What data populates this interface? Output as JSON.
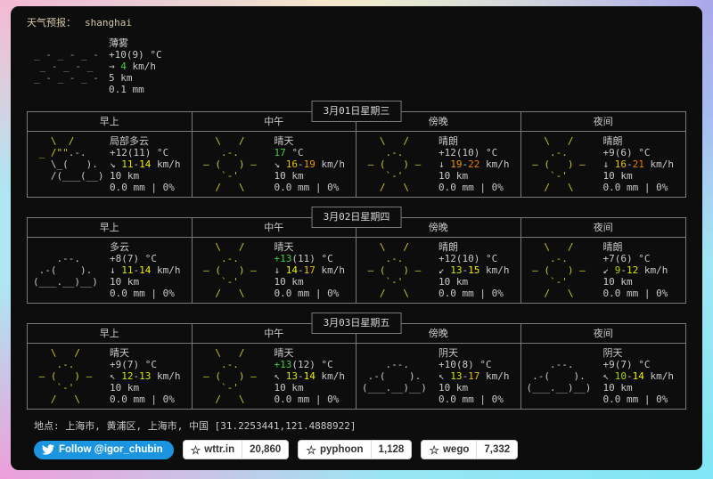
{
  "header": {
    "label": "天气预报：",
    "city": "shanghai"
  },
  "colors": {
    "d": "#c9c9c9",
    "m": "#9a9a9a",
    "y": "#c9c926",
    "g": "#44cc44",
    "yg": "#a8d400",
    "y1": "#d6e600",
    "y2": "#f0f000",
    "gold": "#e6c300",
    "o1": "#e89a00",
    "o2": "#e87c00"
  },
  "arts": {
    "mist": [
      [
        [
          "",
          ""
        ]
      ],
      [
        [
          "_ - _ - _ -",
          "m"
        ]
      ],
      [
        [
          " _ - _ - _",
          "m"
        ]
      ],
      [
        [
          "_ - _ - _ -",
          "m"
        ]
      ],
      [
        [
          "",
          ""
        ]
      ]
    ],
    "partly": [
      [
        [
          "   \\  /",
          "y"
        ]
      ],
      [
        [
          " _ /\"\"",
          "y"
        ],
        [
          ".-.",
          "d"
        ]
      ],
      [
        [
          "   \\_(   ).",
          "d"
        ]
      ],
      [
        [
          "   /(___(__)",
          "d"
        ]
      ],
      [
        [
          "",
          ""
        ]
      ]
    ],
    "sun": [
      [
        [
          "   \\   /",
          "y"
        ]
      ],
      [
        [
          "    .-.",
          "y"
        ]
      ],
      [
        [
          " ― (   ) ―",
          "y"
        ]
      ],
      [
        [
          "    `-'",
          "y"
        ]
      ],
      [
        [
          "   /   \\",
          "y"
        ]
      ]
    ],
    "cloud": [
      [
        [
          "",
          ""
        ]
      ],
      [
        [
          "    .--.",
          "d"
        ]
      ],
      [
        [
          " .-(    ).",
          "d"
        ]
      ],
      [
        [
          "(___.__)__)",
          "d"
        ]
      ],
      [
        [
          "",
          ""
        ]
      ]
    ]
  },
  "current": {
    "art": "mist",
    "lines": [
      [
        [
          "薄雾",
          "d"
        ]
      ],
      [
        [
          "+10(9) °C",
          "d"
        ]
      ],
      [
        [
          "→ ",
          "d"
        ],
        [
          "4",
          "g"
        ],
        [
          " km/h",
          "d"
        ]
      ],
      [
        [
          "5 km",
          "d"
        ]
      ],
      [
        [
          "0.1 mm",
          "d"
        ]
      ]
    ]
  },
  "days": [
    {
      "date": "3月01日星期三",
      "columns": [
        "早上",
        "中午",
        "傍晚",
        "夜间"
      ],
      "cells": [
        {
          "art": "partly",
          "lines": [
            [
              [
                "局部多云",
                "d"
              ]
            ],
            [
              [
                "+12(11) °C",
                "d"
              ]
            ],
            [
              [
                "↘ ",
                "d"
              ],
              [
                "11",
                "y1"
              ],
              [
                "-",
                "d"
              ],
              [
                "14",
                "y2"
              ],
              [
                " km/h",
                "d"
              ]
            ],
            [
              [
                "10 km",
                "d"
              ]
            ],
            [
              [
                "0.0 mm | 0%",
                "d"
              ]
            ]
          ]
        },
        {
          "art": "sun",
          "lines": [
            [
              [
                "晴天",
                "d"
              ]
            ],
            [
              [
                "17",
                "g"
              ],
              [
                " °C",
                "d"
              ]
            ],
            [
              [
                "↘ ",
                "d"
              ],
              [
                "16",
                "gold"
              ],
              [
                "-",
                "d"
              ],
              [
                "19",
                "o1"
              ],
              [
                " km/h",
                "d"
              ]
            ],
            [
              [
                "10 km",
                "d"
              ]
            ],
            [
              [
                "0.0 mm | 0%",
                "d"
              ]
            ]
          ]
        },
        {
          "art": "sun",
          "lines": [
            [
              [
                "晴朗",
                "d"
              ]
            ],
            [
              [
                "+12(10) °C",
                "d"
              ]
            ],
            [
              [
                "↓ ",
                "d"
              ],
              [
                "19",
                "o1"
              ],
              [
                "-",
                "d"
              ],
              [
                "22",
                "o2"
              ],
              [
                " km/h",
                "d"
              ]
            ],
            [
              [
                "10 km",
                "d"
              ]
            ],
            [
              [
                "0.0 mm | 0%",
                "d"
              ]
            ]
          ]
        },
        {
          "art": "sun",
          "lines": [
            [
              [
                "晴朗",
                "d"
              ]
            ],
            [
              [
                "+9(6) °C",
                "d"
              ]
            ],
            [
              [
                "↓ ",
                "d"
              ],
              [
                "16",
                "gold"
              ],
              [
                "-",
                "d"
              ],
              [
                "21",
                "o2"
              ],
              [
                " km/h",
                "d"
              ]
            ],
            [
              [
                "10 km",
                "d"
              ]
            ],
            [
              [
                "0.0 mm | 0%",
                "d"
              ]
            ]
          ]
        }
      ]
    },
    {
      "date": "3月02日星期四",
      "columns": [
        "早上",
        "中午",
        "傍晚",
        "夜间"
      ],
      "cells": [
        {
          "art": "cloud",
          "lines": [
            [
              [
                "多云",
                "d"
              ]
            ],
            [
              [
                "+8(7) °C",
                "d"
              ]
            ],
            [
              [
                "↓ ",
                "d"
              ],
              [
                "11",
                "y1"
              ],
              [
                "-",
                "d"
              ],
              [
                "14",
                "y2"
              ],
              [
                " km/h",
                "d"
              ]
            ],
            [
              [
                "10 km",
                "d"
              ]
            ],
            [
              [
                "0.0 mm | 0%",
                "d"
              ]
            ]
          ]
        },
        {
          "art": "sun",
          "lines": [
            [
              [
                "晴天",
                "d"
              ]
            ],
            [
              [
                "+13",
                "g"
              ],
              [
                "(11) °C",
                "d"
              ]
            ],
            [
              [
                "↓ ",
                "d"
              ],
              [
                "14",
                "y2"
              ],
              [
                "-",
                "d"
              ],
              [
                "17",
                "gold"
              ],
              [
                " km/h",
                "d"
              ]
            ],
            [
              [
                "10 km",
                "d"
              ]
            ],
            [
              [
                "0.0 mm | 0%",
                "d"
              ]
            ]
          ]
        },
        {
          "art": "sun",
          "lines": [
            [
              [
                "晴朗",
                "d"
              ]
            ],
            [
              [
                "+12(10) °C",
                "d"
              ]
            ],
            [
              [
                "↙ ",
                "d"
              ],
              [
                "13",
                "y1"
              ],
              [
                "-",
                "d"
              ],
              [
                "15",
                "y2"
              ],
              [
                " km/h",
                "d"
              ]
            ],
            [
              [
                "10 km",
                "d"
              ]
            ],
            [
              [
                "0.0 mm | 0%",
                "d"
              ]
            ]
          ]
        },
        {
          "art": "sun",
          "lines": [
            [
              [
                "晴朗",
                "d"
              ]
            ],
            [
              [
                "+7(6) °C",
                "d"
              ]
            ],
            [
              [
                "↙ ",
                "d"
              ],
              [
                "9",
                "yg"
              ],
              [
                "-",
                "d"
              ],
              [
                "12",
                "y1"
              ],
              [
                " km/h",
                "d"
              ]
            ],
            [
              [
                "10 km",
                "d"
              ]
            ],
            [
              [
                "0.0 mm | 0%",
                "d"
              ]
            ]
          ]
        }
      ]
    },
    {
      "date": "3月03日星期五",
      "columns": [
        "早上",
        "中午",
        "傍晚",
        "夜间"
      ],
      "cells": [
        {
          "art": "sun",
          "lines": [
            [
              [
                "晴天",
                "d"
              ]
            ],
            [
              [
                "+9(7) °C",
                "d"
              ]
            ],
            [
              [
                "↖ ",
                "d"
              ],
              [
                "12",
                "y1"
              ],
              [
                "-",
                "d"
              ],
              [
                "13",
                "y1"
              ],
              [
                " km/h",
                "d"
              ]
            ],
            [
              [
                "10 km",
                "d"
              ]
            ],
            [
              [
                "0.0 mm | 0%",
                "d"
              ]
            ]
          ]
        },
        {
          "art": "sun",
          "lines": [
            [
              [
                "晴天",
                "d"
              ]
            ],
            [
              [
                "+13",
                "g"
              ],
              [
                "(12) °C",
                "d"
              ]
            ],
            [
              [
                "↖ ",
                "d"
              ],
              [
                "13",
                "y1"
              ],
              [
                "-",
                "d"
              ],
              [
                "14",
                "y2"
              ],
              [
                " km/h",
                "d"
              ]
            ],
            [
              [
                "10 km",
                "d"
              ]
            ],
            [
              [
                "0.0 mm | 0%",
                "d"
              ]
            ]
          ]
        },
        {
          "art": "cloud",
          "lines": [
            [
              [
                "阴天",
                "d"
              ]
            ],
            [
              [
                "+10(8) °C",
                "d"
              ]
            ],
            [
              [
                "↖ ",
                "d"
              ],
              [
                "13",
                "y1"
              ],
              [
                "-",
                "d"
              ],
              [
                "17",
                "gold"
              ],
              [
                " km/h",
                "d"
              ]
            ],
            [
              [
                "10 km",
                "d"
              ]
            ],
            [
              [
                "0.0 mm | 0%",
                "d"
              ]
            ]
          ]
        },
        {
          "art": "cloud",
          "lines": [
            [
              [
                "阴天",
                "d"
              ]
            ],
            [
              [
                "+9(7) °C",
                "d"
              ]
            ],
            [
              [
                "↖ ",
                "d"
              ],
              [
                "10",
                "yg"
              ],
              [
                "-",
                "d"
              ],
              [
                "14",
                "y2"
              ],
              [
                " km/h",
                "d"
              ]
            ],
            [
              [
                "10 km",
                "d"
              ]
            ],
            [
              [
                "0.0 mm | 0%",
                "d"
              ]
            ]
          ]
        }
      ]
    }
  ],
  "footer": {
    "location": "地点: 上海市, 黄浦区, 上海市, 中国 [31.2253441,121.4888922]"
  },
  "badges": {
    "twitter": "Follow @igor_chubin",
    "twitter_color": "#1b95e0",
    "star_icon": "☆",
    "github": [
      {
        "name": "wttr.in",
        "count": "20,860"
      },
      {
        "name": "pyphoon",
        "count": "1,128"
      },
      {
        "name": "wego",
        "count": "7,332"
      }
    ]
  }
}
